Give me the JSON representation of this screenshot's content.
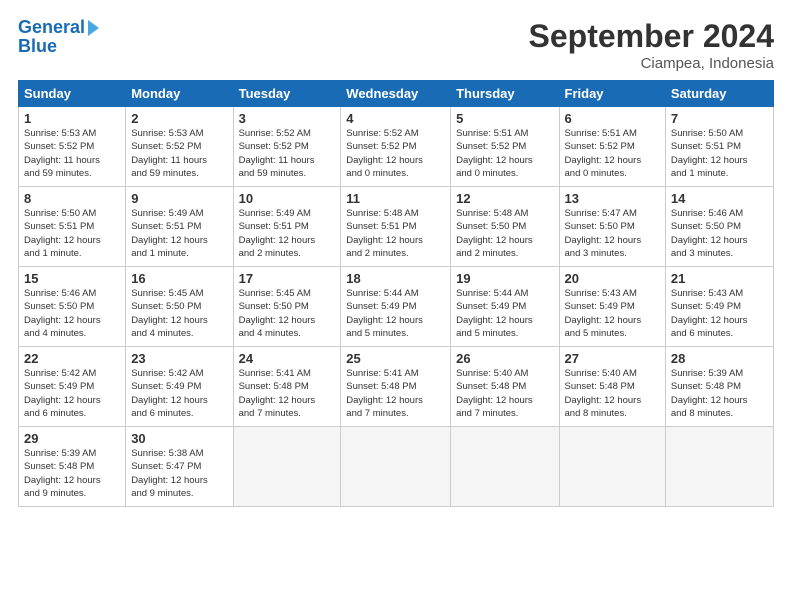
{
  "logo": {
    "line1": "General",
    "line2": "Blue"
  },
  "title": "September 2024",
  "subtitle": "Ciampea, Indonesia",
  "days_of_week": [
    "Sunday",
    "Monday",
    "Tuesday",
    "Wednesday",
    "Thursday",
    "Friday",
    "Saturday"
  ],
  "weeks": [
    [
      {
        "day": 1,
        "info": "Sunrise: 5:53 AM\nSunset: 5:52 PM\nDaylight: 11 hours\nand 59 minutes."
      },
      {
        "day": 2,
        "info": "Sunrise: 5:53 AM\nSunset: 5:52 PM\nDaylight: 11 hours\nand 59 minutes."
      },
      {
        "day": 3,
        "info": "Sunrise: 5:52 AM\nSunset: 5:52 PM\nDaylight: 11 hours\nand 59 minutes."
      },
      {
        "day": 4,
        "info": "Sunrise: 5:52 AM\nSunset: 5:52 PM\nDaylight: 12 hours\nand 0 minutes."
      },
      {
        "day": 5,
        "info": "Sunrise: 5:51 AM\nSunset: 5:52 PM\nDaylight: 12 hours\nand 0 minutes."
      },
      {
        "day": 6,
        "info": "Sunrise: 5:51 AM\nSunset: 5:52 PM\nDaylight: 12 hours\nand 0 minutes."
      },
      {
        "day": 7,
        "info": "Sunrise: 5:50 AM\nSunset: 5:51 PM\nDaylight: 12 hours\nand 1 minute."
      }
    ],
    [
      {
        "day": 8,
        "info": "Sunrise: 5:50 AM\nSunset: 5:51 PM\nDaylight: 12 hours\nand 1 minute."
      },
      {
        "day": 9,
        "info": "Sunrise: 5:49 AM\nSunset: 5:51 PM\nDaylight: 12 hours\nand 1 minute."
      },
      {
        "day": 10,
        "info": "Sunrise: 5:49 AM\nSunset: 5:51 PM\nDaylight: 12 hours\nand 2 minutes."
      },
      {
        "day": 11,
        "info": "Sunrise: 5:48 AM\nSunset: 5:51 PM\nDaylight: 12 hours\nand 2 minutes."
      },
      {
        "day": 12,
        "info": "Sunrise: 5:48 AM\nSunset: 5:50 PM\nDaylight: 12 hours\nand 2 minutes."
      },
      {
        "day": 13,
        "info": "Sunrise: 5:47 AM\nSunset: 5:50 PM\nDaylight: 12 hours\nand 3 minutes."
      },
      {
        "day": 14,
        "info": "Sunrise: 5:46 AM\nSunset: 5:50 PM\nDaylight: 12 hours\nand 3 minutes."
      }
    ],
    [
      {
        "day": 15,
        "info": "Sunrise: 5:46 AM\nSunset: 5:50 PM\nDaylight: 12 hours\nand 4 minutes."
      },
      {
        "day": 16,
        "info": "Sunrise: 5:45 AM\nSunset: 5:50 PM\nDaylight: 12 hours\nand 4 minutes."
      },
      {
        "day": 17,
        "info": "Sunrise: 5:45 AM\nSunset: 5:50 PM\nDaylight: 12 hours\nand 4 minutes."
      },
      {
        "day": 18,
        "info": "Sunrise: 5:44 AM\nSunset: 5:49 PM\nDaylight: 12 hours\nand 5 minutes."
      },
      {
        "day": 19,
        "info": "Sunrise: 5:44 AM\nSunset: 5:49 PM\nDaylight: 12 hours\nand 5 minutes."
      },
      {
        "day": 20,
        "info": "Sunrise: 5:43 AM\nSunset: 5:49 PM\nDaylight: 12 hours\nand 5 minutes."
      },
      {
        "day": 21,
        "info": "Sunrise: 5:43 AM\nSunset: 5:49 PM\nDaylight: 12 hours\nand 6 minutes."
      }
    ],
    [
      {
        "day": 22,
        "info": "Sunrise: 5:42 AM\nSunset: 5:49 PM\nDaylight: 12 hours\nand 6 minutes."
      },
      {
        "day": 23,
        "info": "Sunrise: 5:42 AM\nSunset: 5:49 PM\nDaylight: 12 hours\nand 6 minutes."
      },
      {
        "day": 24,
        "info": "Sunrise: 5:41 AM\nSunset: 5:48 PM\nDaylight: 12 hours\nand 7 minutes."
      },
      {
        "day": 25,
        "info": "Sunrise: 5:41 AM\nSunset: 5:48 PM\nDaylight: 12 hours\nand 7 minutes."
      },
      {
        "day": 26,
        "info": "Sunrise: 5:40 AM\nSunset: 5:48 PM\nDaylight: 12 hours\nand 7 minutes."
      },
      {
        "day": 27,
        "info": "Sunrise: 5:40 AM\nSunset: 5:48 PM\nDaylight: 12 hours\nand 8 minutes."
      },
      {
        "day": 28,
        "info": "Sunrise: 5:39 AM\nSunset: 5:48 PM\nDaylight: 12 hours\nand 8 minutes."
      }
    ],
    [
      {
        "day": 29,
        "info": "Sunrise: 5:39 AM\nSunset: 5:48 PM\nDaylight: 12 hours\nand 9 minutes."
      },
      {
        "day": 30,
        "info": "Sunrise: 5:38 AM\nSunset: 5:47 PM\nDaylight: 12 hours\nand 9 minutes."
      },
      {
        "day": null,
        "info": ""
      },
      {
        "day": null,
        "info": ""
      },
      {
        "day": null,
        "info": ""
      },
      {
        "day": null,
        "info": ""
      },
      {
        "day": null,
        "info": ""
      }
    ]
  ]
}
